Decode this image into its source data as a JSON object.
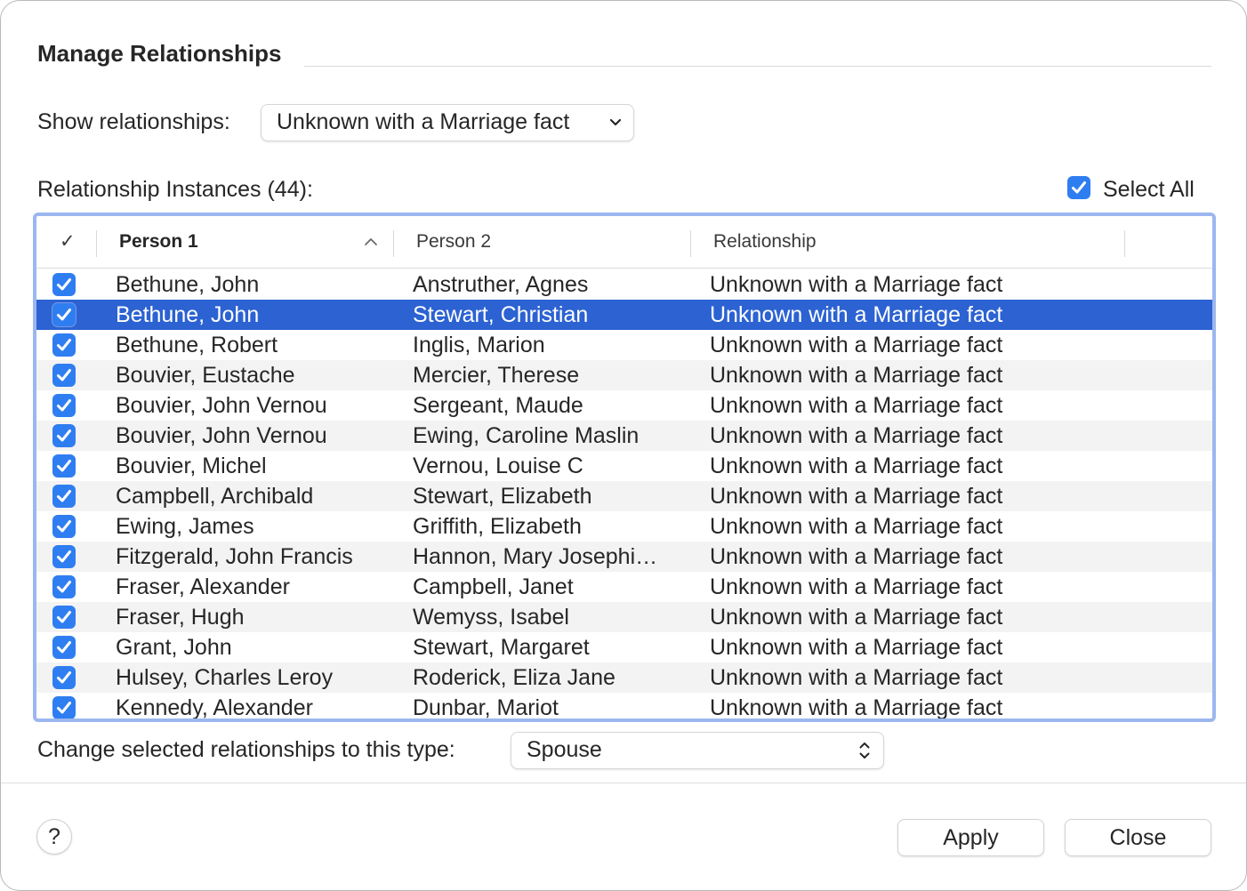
{
  "dialog": {
    "title": "Manage Relationships"
  },
  "filter": {
    "label": "Show relationships:",
    "value": "Unknown with a Marriage fact"
  },
  "instances": {
    "label": "Relationship Instances (44):",
    "select_all_label": "Select All",
    "select_all_checked": true
  },
  "table": {
    "columns": [
      {
        "label": "✓",
        "key": "check"
      },
      {
        "label": "Person 1",
        "key": "person1",
        "sorted": "ascending"
      },
      {
        "label": "Person 2",
        "key": "person2"
      },
      {
        "label": "Relationship",
        "key": "relationship"
      }
    ],
    "rows": [
      {
        "checked": true,
        "person1": "Bethune, John",
        "person2": "Anstruther, Agnes",
        "relationship": "Unknown with a Marriage fact",
        "selected": false
      },
      {
        "checked": true,
        "person1": "Bethune, John",
        "person2": "Stewart, Christian",
        "relationship": "Unknown with a Marriage fact",
        "selected": true
      },
      {
        "checked": true,
        "person1": "Bethune, Robert",
        "person2": "Inglis, Marion",
        "relationship": "Unknown with a Marriage fact",
        "selected": false
      },
      {
        "checked": true,
        "person1": "Bouvier, Eustache",
        "person2": "Mercier, Therese",
        "relationship": "Unknown with a Marriage fact",
        "selected": false
      },
      {
        "checked": true,
        "person1": "Bouvier, John Vernou",
        "person2": "Sergeant, Maude",
        "relationship": "Unknown with a Marriage fact",
        "selected": false
      },
      {
        "checked": true,
        "person1": "Bouvier, John Vernou",
        "person2": "Ewing, Caroline Maslin",
        "relationship": "Unknown with a Marriage fact",
        "selected": false
      },
      {
        "checked": true,
        "person1": "Bouvier, Michel",
        "person2": "Vernou, Louise C",
        "relationship": "Unknown with a Marriage fact",
        "selected": false
      },
      {
        "checked": true,
        "person1": "Campbell, Archibald",
        "person2": "Stewart, Elizabeth",
        "relationship": "Unknown with a Marriage fact",
        "selected": false
      },
      {
        "checked": true,
        "person1": "Ewing, James",
        "person2": "Griffith, Elizabeth",
        "relationship": "Unknown with a Marriage fact",
        "selected": false
      },
      {
        "checked": true,
        "person1": "Fitzgerald, John Francis",
        "person2": "Hannon, Mary Josephi…",
        "relationship": "Unknown with a Marriage fact",
        "selected": false
      },
      {
        "checked": true,
        "person1": "Fraser, Alexander",
        "person2": "Campbell, Janet",
        "relationship": "Unknown with a Marriage fact",
        "selected": false
      },
      {
        "checked": true,
        "person1": "Fraser, Hugh",
        "person2": "Wemyss, Isabel",
        "relationship": "Unknown with a Marriage fact",
        "selected": false
      },
      {
        "checked": true,
        "person1": "Grant, John",
        "person2": "Stewart, Margaret",
        "relationship": "Unknown with a Marriage fact",
        "selected": false
      },
      {
        "checked": true,
        "person1": "Hulsey, Charles Leroy",
        "person2": "Roderick, Eliza Jane",
        "relationship": "Unknown with a Marriage fact",
        "selected": false
      },
      {
        "checked": true,
        "person1": "Kennedy, Alexander",
        "person2": "Dunbar, Mariot",
        "relationship": "Unknown with a Marriage fact",
        "selected": false
      }
    ]
  },
  "change_type": {
    "label": "Change selected relationships to this type:",
    "value": "Spouse"
  },
  "footer": {
    "help_label": "?",
    "apply_label": "Apply",
    "close_label": "Close"
  },
  "colors": {
    "accent": "#2f7ef1",
    "selection": "#2c62d2",
    "focus_ring": "#9cb7ef",
    "alt_row": "#f3f3f3"
  },
  "icons": {
    "checkbox": "checkbox-checked-icon",
    "sort": "sort-ascending-icon",
    "popup": "chevron-down-icon",
    "stepper": "updown-chevron-icon"
  }
}
